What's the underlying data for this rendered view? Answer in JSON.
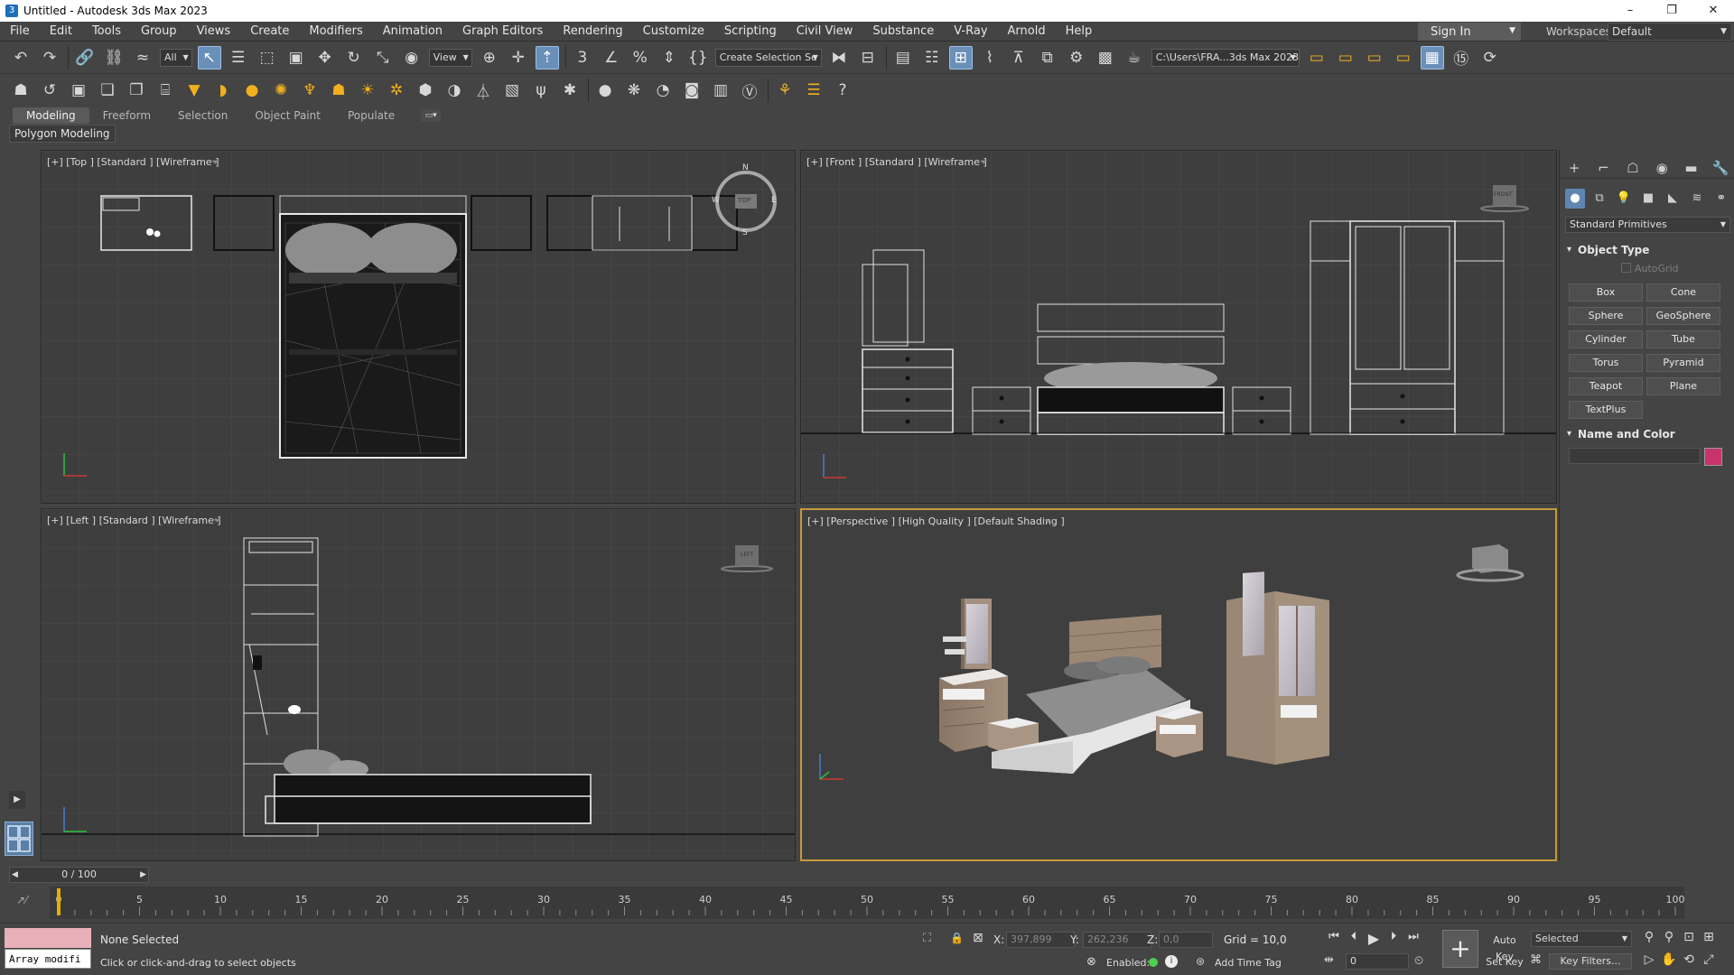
{
  "window": {
    "title": "Untitled - Autodesk 3ds Max 2023",
    "icon_label": "3",
    "minimize": "–",
    "restore": "❐",
    "close": "✕"
  },
  "menu": [
    "File",
    "Edit",
    "Tools",
    "Group",
    "Views",
    "Create",
    "Modifiers",
    "Animation",
    "Graph Editors",
    "Rendering",
    "Customize",
    "Scripting",
    "Civil View",
    "Substance",
    "V-Ray",
    "Arnold",
    "Help"
  ],
  "account": {
    "sign_in": "Sign In",
    "workspaces_label": "Workspaces:",
    "workspace_value": "Default"
  },
  "toolbar": {
    "selection_filter": "All",
    "ref_coord": "View",
    "named_selection": "Create Selection Se",
    "project_path": "C:\\Users\\FRA...3ds Max 2023"
  },
  "ribbon": {
    "tabs": [
      "Modeling",
      "Freeform",
      "Selection",
      "Object Paint",
      "Populate"
    ],
    "active_tab": "Modeling",
    "panel_label": "Polygon Modeling"
  },
  "viewports": {
    "top": {
      "label": "[+] [Top ] [Standard ] [Wireframe ]"
    },
    "front": {
      "label": "[+] [Front ] [Standard ] [Wireframe ]"
    },
    "left": {
      "label": "[+] [Left ] [Standard ] [Wireframe ]"
    },
    "perspective": {
      "label": "[+] [Perspective ] [High Quality ] [Default Shading ]"
    },
    "compass": {
      "n": "N",
      "s": "S",
      "e": "E",
      "w": "W"
    },
    "viewcube": {
      "top": "TOP",
      "front": "FRONT",
      "left": "LEFT"
    }
  },
  "command_panel": {
    "category": "Standard Primitives",
    "object_type_title": "Object Type",
    "autogrid": "AutoGrid",
    "buttons": [
      "Box",
      "Cone",
      "Sphere",
      "GeoSphere",
      "Cylinder",
      "Tube",
      "Torus",
      "Pyramid",
      "Teapot",
      "Plane",
      "TextPlus"
    ],
    "name_color_title": "Name and Color",
    "object_color": "#c7346c"
  },
  "timeline": {
    "slider_text": "0 / 100",
    "ticks": [
      0,
      5,
      10,
      15,
      20,
      25,
      30,
      35,
      40,
      45,
      50,
      55,
      60,
      65,
      70,
      75,
      80,
      85,
      90,
      95,
      100
    ]
  },
  "status": {
    "maxscript_text": "Array modifi",
    "selection": "None Selected",
    "prompt": "Click or click-and-drag to select objects",
    "x_label": "X:",
    "x_value": "397,899",
    "y_label": "Y:",
    "y_value": "262,236",
    "z_label": "Z:",
    "z_value": "0,0",
    "grid": "Grid = 10,0",
    "enabled": "Enabled:",
    "add_time_tag": "Add Time Tag",
    "auto_key": "Auto Key",
    "set_key": "Set Key",
    "selected": "Selected",
    "key_filters": "Key Filters...",
    "frame": "0"
  }
}
